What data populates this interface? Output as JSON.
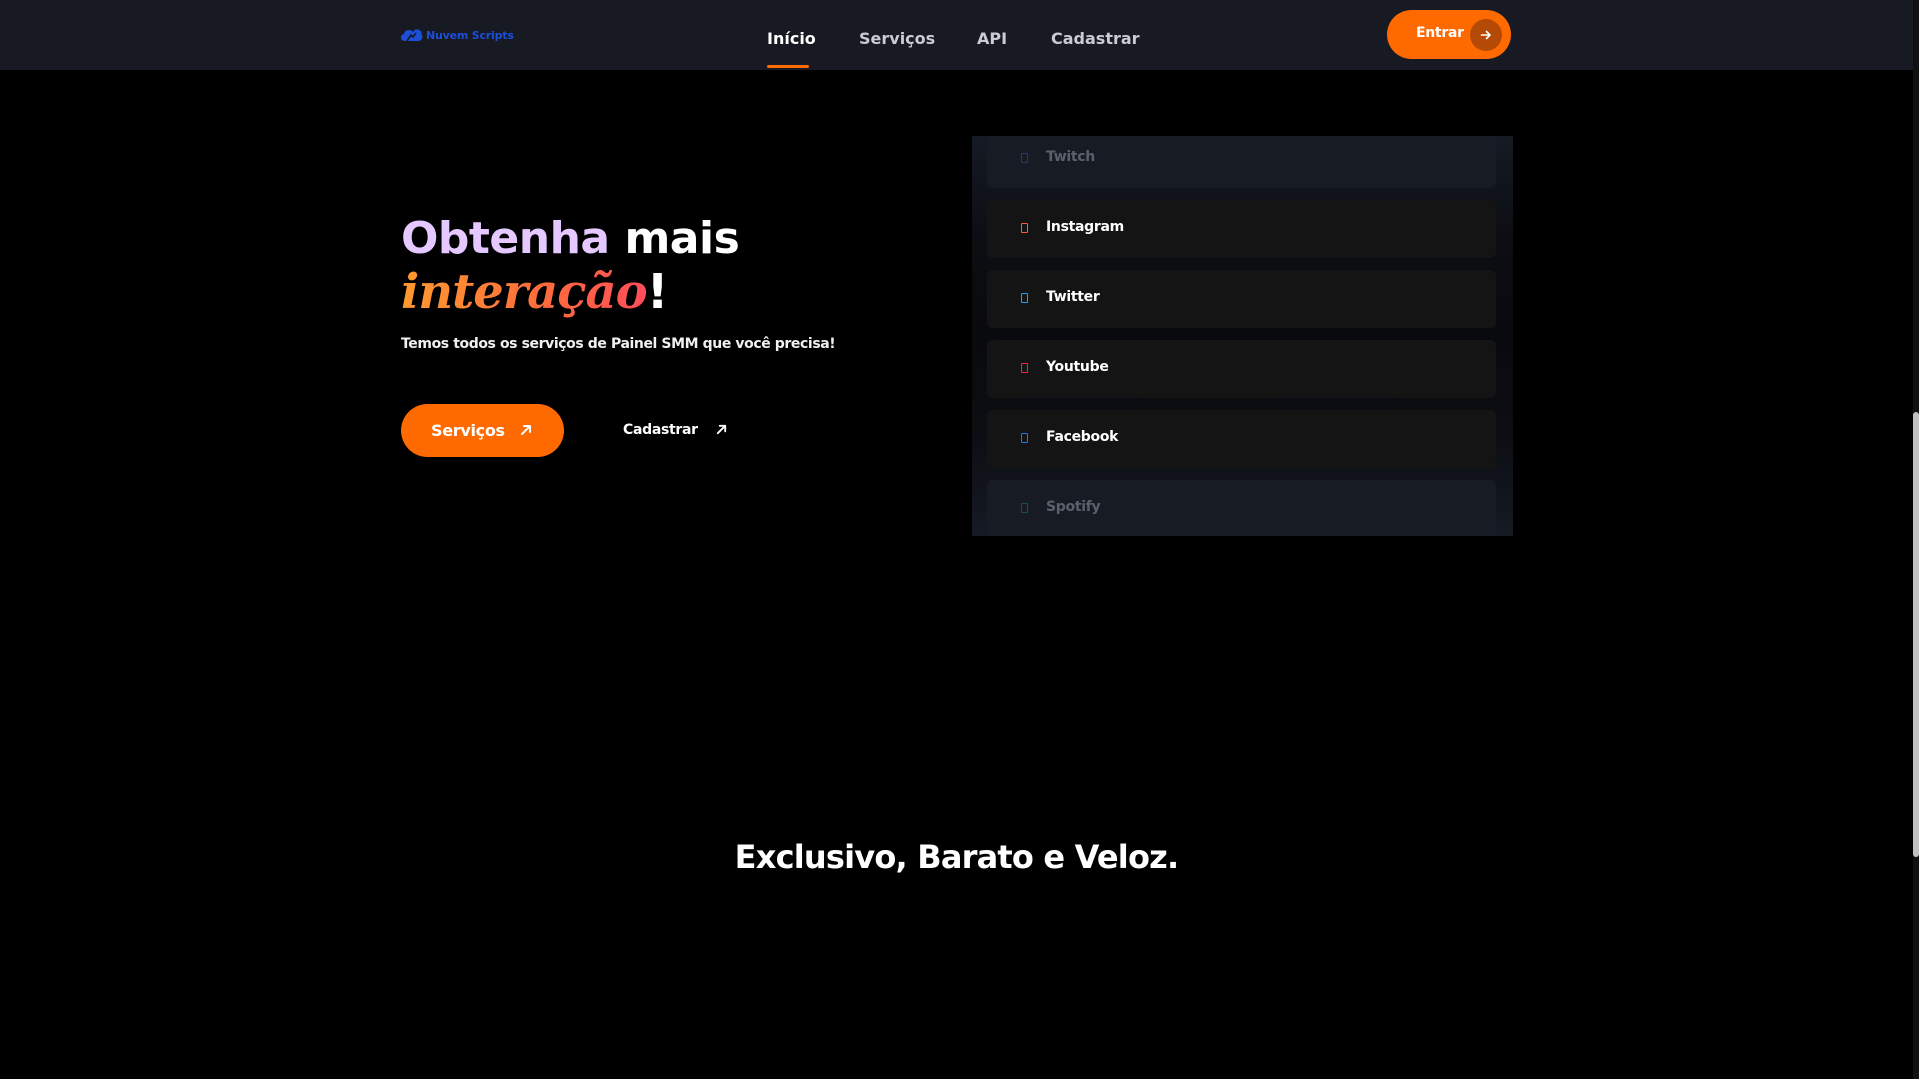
{
  "colors": {
    "accent": "#ff6a00",
    "navbar_bg": "#171a22",
    "page_bg": "#000000",
    "logo_blue": "#1d4ed8",
    "title_lavender": "#e4c8ff"
  },
  "header": {
    "logo_text": "Nuvem Scripts",
    "logo_icon": "cloud-icon",
    "nav": [
      {
        "label": "Início",
        "active": true
      },
      {
        "label": "Serviços",
        "active": false
      },
      {
        "label": "API",
        "active": false
      },
      {
        "label": "Cadastrar",
        "active": false
      }
    ],
    "login_button": {
      "label": "Entrar",
      "icon": "arrow-right-icon"
    }
  },
  "hero": {
    "title_part1": "Obtenha",
    "title_part2": " mais",
    "title_highlight": "interação",
    "title_end": "!",
    "subtitle": "Temos todos os serviços de Painel SMM que você precisa!",
    "primary_button": {
      "label": "Serviços",
      "icon": "arrow-up-right-icon"
    },
    "secondary_button": {
      "label": "Cadastrar",
      "icon": "arrow-up-right-icon"
    }
  },
  "social_list": [
    {
      "label": "Twitch",
      "icon": "twitch-icon",
      "color": "#9146ff",
      "faded": true
    },
    {
      "label": "Instagram",
      "icon": "instagram-icon",
      "color": "#ff5a3d",
      "faded": false
    },
    {
      "label": "Twitter",
      "icon": "twitter-icon",
      "color": "#1da1f2",
      "faded": false
    },
    {
      "label": "Youtube",
      "icon": "youtube-icon",
      "color": "#ff1f3d",
      "faded": false
    },
    {
      "label": "Facebook",
      "icon": "facebook-icon",
      "color": "#1877f2",
      "faded": false
    },
    {
      "label": "Spotify",
      "icon": "spotify-icon",
      "color": "#1db954",
      "faded": true
    }
  ],
  "section": {
    "heading": "Exclusivo, Barato e Veloz."
  }
}
